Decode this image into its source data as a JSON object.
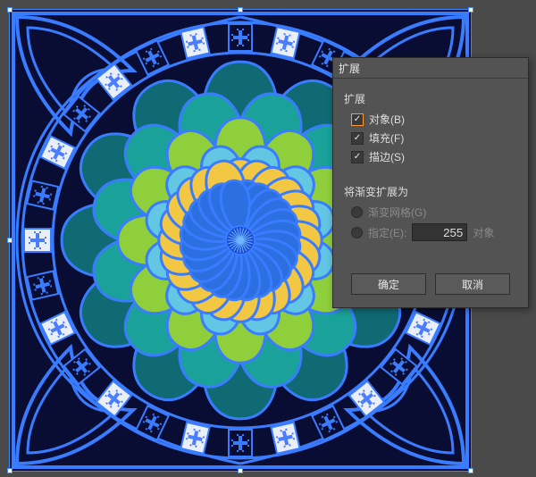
{
  "dialog": {
    "title": "扩展",
    "group1": {
      "title": "扩展",
      "object": {
        "label": "对象(B)",
        "checked": true,
        "highlight": true
      },
      "fill": {
        "label": "填充(F)",
        "checked": true,
        "highlight": false
      },
      "stroke": {
        "label": "描边(S)",
        "checked": true,
        "highlight": false
      }
    },
    "group2": {
      "title": "将渐变扩展为",
      "mesh": {
        "label": "渐变网格(G)",
        "enabled": false
      },
      "specify": {
        "label": "指定(E):",
        "enabled": false,
        "value": "255",
        "suffix": "对象"
      }
    },
    "buttons": {
      "ok": "确定",
      "cancel": "取消"
    }
  },
  "art": {
    "bg": "#0a0d33",
    "palette": {
      "outline": "#3a7cff",
      "darkTeal": "#0f6a74",
      "teal": "#1aa29a",
      "green": "#8fcf3c",
      "sky": "#63c6e3",
      "pale": "#bde3f2",
      "yellow": "#f2c744",
      "cross": "#4a7dff",
      "tile": "#e9eef7"
    }
  }
}
